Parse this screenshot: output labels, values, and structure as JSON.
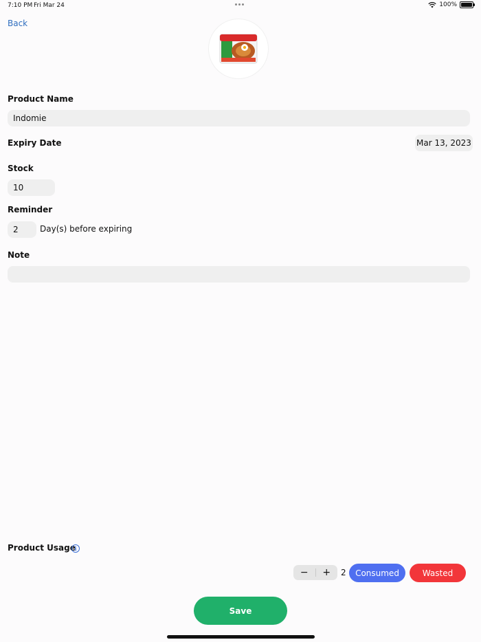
{
  "status_bar": {
    "time": "7:10 PM",
    "date": "Fri Mar 24",
    "battery": "100%"
  },
  "nav": {
    "back_label": "Back"
  },
  "product": {
    "image_alt": "Indomie"
  },
  "form": {
    "product_name_label": "Product Name",
    "product_name_value": "Indomie",
    "expiry_date_label": "Expiry Date",
    "expiry_date_value": "Mar 13, 2023",
    "stock_label": "Stock",
    "stock_value": "10",
    "reminder_label": "Reminder",
    "reminder_value": "2",
    "reminder_suffix": "Day(s) before expiring",
    "note_label": "Note",
    "note_value": ""
  },
  "usage": {
    "label": "Product Usage",
    "count": "2",
    "minus_label": "−",
    "plus_label": "+",
    "consumed_label": "Consumed",
    "wasted_label": "Wasted"
  },
  "actions": {
    "save_label": "Save"
  },
  "colors": {
    "accent_link": "#2f6ebf",
    "consumed": "#4f6ff0",
    "wasted": "#f2363a",
    "save": "#20b06a"
  }
}
